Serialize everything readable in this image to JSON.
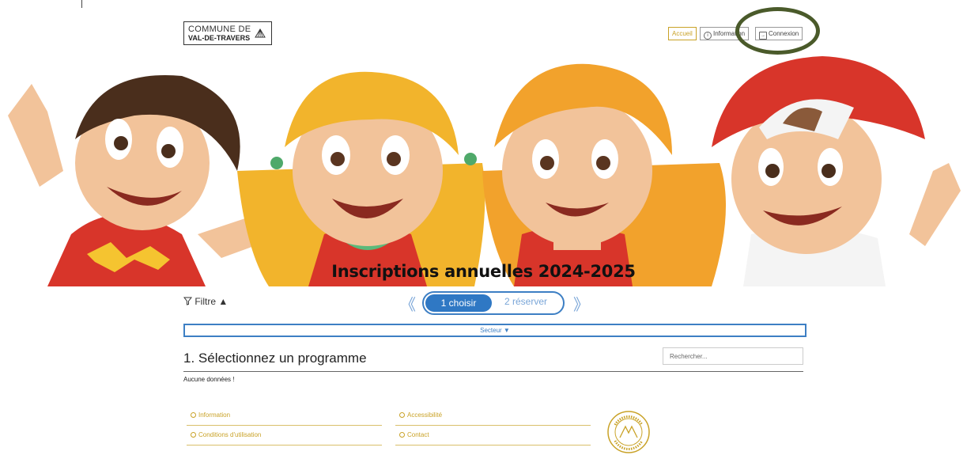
{
  "logo": {
    "line1": "COMMUNE DE",
    "line2": "VAL-DE-TRAVERS"
  },
  "nav": {
    "home": "Accueil",
    "info": "Information",
    "login": "Connexion"
  },
  "banner": {
    "title": "Inscriptions annuelles 2024-2025"
  },
  "filter": {
    "label": "Filtre ▲"
  },
  "steps": {
    "prev": "《",
    "step1": "1 choisir",
    "step2": "2 réserver",
    "next": "》"
  },
  "sector": {
    "label": "Secteur ▼"
  },
  "main": {
    "heading": "1. Sélectionnez un programme",
    "empty": "Aucune données !"
  },
  "search": {
    "placeholder": "Rechercher..."
  },
  "footer": {
    "information": "Information",
    "accessibility": "Accessibilité",
    "terms": "Conditions d'utilisation",
    "contact": "Contact"
  },
  "colors": {
    "accent": "#c9a227",
    "primary": "#2f78c4",
    "annotation": "#4a5a2a"
  }
}
